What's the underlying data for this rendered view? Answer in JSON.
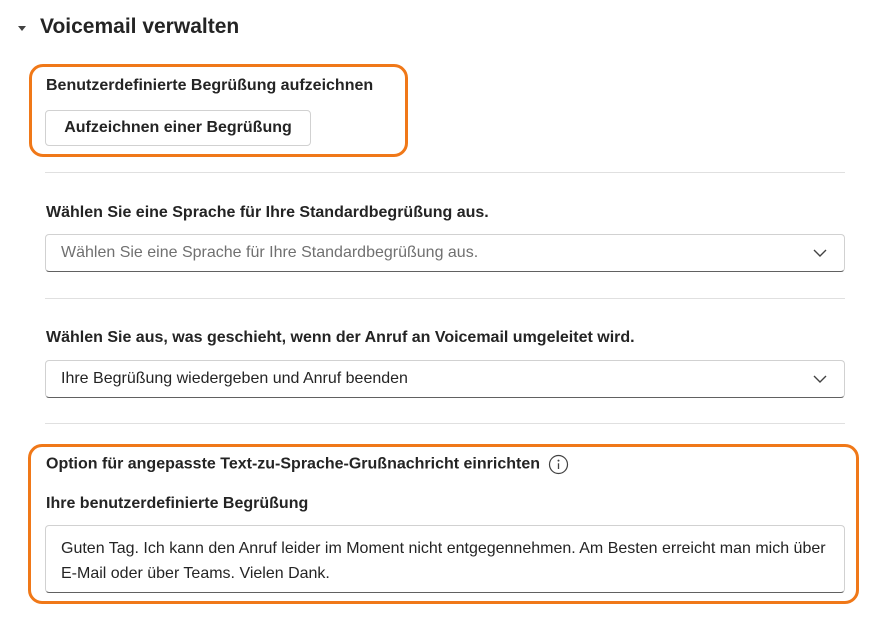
{
  "section": {
    "title": "Voicemail verwalten"
  },
  "record_greeting": {
    "label": "Benutzerdefinierte Begrüßung aufzeichnen",
    "button_label": "Aufzeichnen einer Begrüßung"
  },
  "language": {
    "label": "Wählen Sie eine Sprache für Ihre Standardbegrüßung aus.",
    "placeholder": "Wählen Sie eine Sprache für Ihre Standardbegrüßung aus."
  },
  "redirect_action": {
    "label": "Wählen Sie aus, was geschieht, wenn der Anruf an Voicemail umgeleitet wird.",
    "value": "Ihre Begrüßung wiedergeben und Anruf beenden"
  },
  "tts": {
    "label": "Option für angepasste Text-zu-Sprache-Grußnachricht einrichten",
    "info_icon": "info-icon",
    "greeting_label": "Ihre benutzerdefinierte Begrüßung",
    "greeting_value": "Guten Tag. Ich kann den Anruf leider im Moment nicht entgegennehmen. Am Besten erreicht man mich über E-Mail oder über Teams. Vielen Dank."
  },
  "colors": {
    "highlight": "#f07818",
    "text": "#242424",
    "border": "#d1d1d1"
  }
}
